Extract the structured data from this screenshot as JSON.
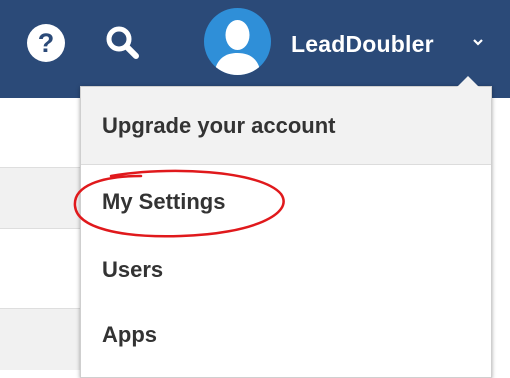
{
  "header": {
    "help_icon": "question-circle-icon",
    "help_glyph": "?",
    "search_icon": "search-icon",
    "avatar_icon": "user-silhouette-icon",
    "user_name": "LeadDoubler",
    "caret_icon": "chevron-down-icon",
    "bar_color": "#2b4a78"
  },
  "dropdown": {
    "items": [
      {
        "label": "Upgrade your account"
      },
      {
        "label": "My Settings"
      },
      {
        "label": "Users"
      },
      {
        "label": "Apps"
      }
    ]
  },
  "annotation": {
    "color": "#e0191c"
  }
}
